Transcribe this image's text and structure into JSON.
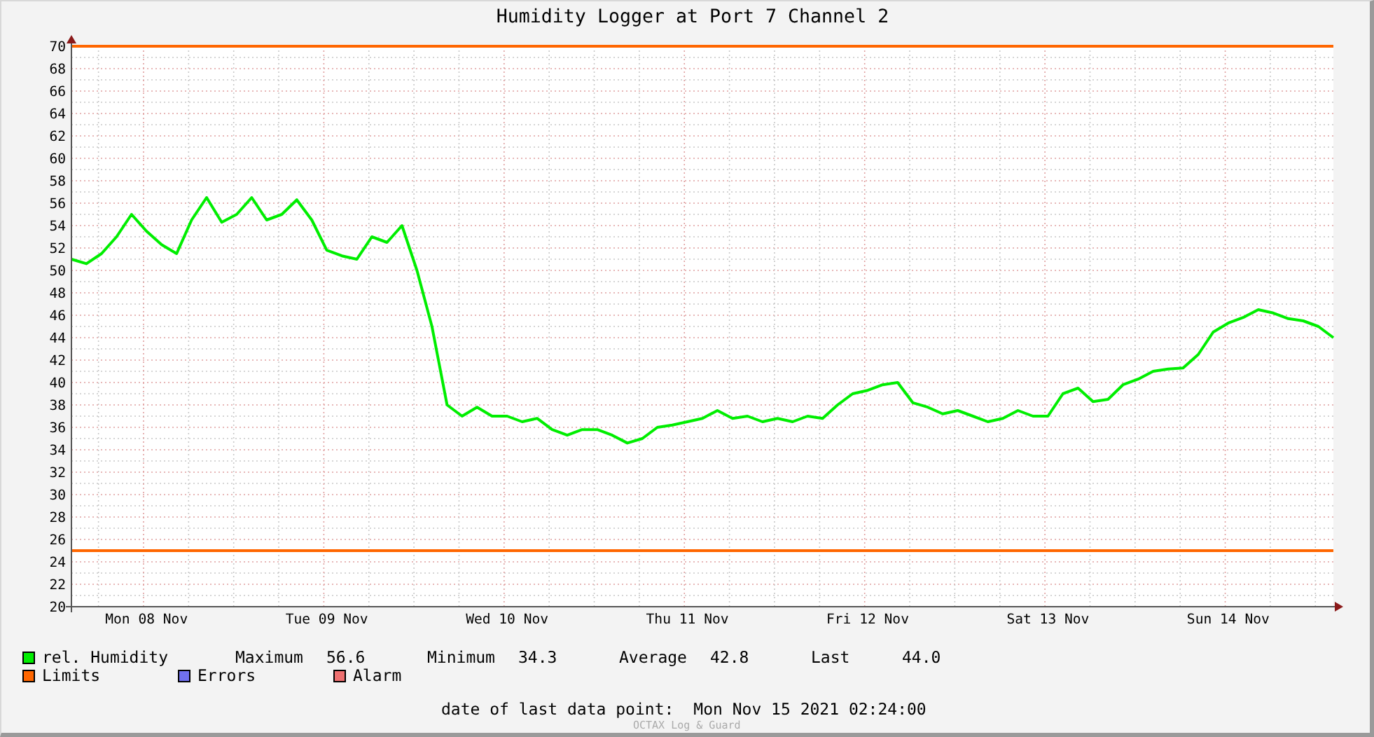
{
  "title": "Humidity Logger at Port 7 Channel 2",
  "chart": {
    "chart_data": {
      "type": "line",
      "ylim": [
        20,
        70
      ],
      "grid": true,
      "ref_lines": [
        {
          "axis": "y",
          "value": 70,
          "color": "#ff6600"
        },
        {
          "axis": "y",
          "value": 25,
          "color": "#ff6600"
        }
      ],
      "yticks": [
        20,
        22,
        24,
        26,
        28,
        30,
        32,
        34,
        36,
        38,
        40,
        42,
        44,
        46,
        48,
        50,
        52,
        54,
        56,
        58,
        60,
        62,
        64,
        66,
        68,
        70
      ],
      "categories": [
        null,
        null,
        null,
        null,
        null,
        "Mon 08 Nov",
        null,
        null,
        null,
        null,
        null,
        null,
        null,
        null,
        null,
        null,
        null,
        "Tue 09 Nov",
        null,
        null,
        null,
        null,
        null,
        null,
        null,
        null,
        null,
        null,
        null,
        "Wed 10 Nov",
        null,
        null,
        null,
        null,
        null,
        null,
        null,
        null,
        null,
        null,
        null,
        "Thu 11 Nov",
        null,
        null,
        null,
        null,
        null,
        null,
        null,
        null,
        null,
        null,
        null,
        "Fri 12 Nov",
        null,
        null,
        null,
        null,
        null,
        null,
        null,
        null,
        null,
        null,
        null,
        "Sat 13 Nov",
        null,
        null,
        null,
        null,
        null,
        null,
        null,
        null,
        null,
        null,
        null,
        "Sun 14 Nov",
        null,
        null,
        null,
        null,
        null,
        null,
        null
      ],
      "series": [
        {
          "name": "rel. Humidity",
          "color": "#00ee00",
          "values": [
            51,
            50.6,
            51.5,
            53,
            55,
            53.5,
            52.3,
            51.5,
            54.5,
            56.5,
            54.3,
            55,
            56.5,
            54.5,
            55,
            56.3,
            54.5,
            51.8,
            51.3,
            51,
            53,
            52.5,
            54,
            50,
            45,
            38,
            37,
            37.8,
            37,
            37,
            36.5,
            36.8,
            35.8,
            35.3,
            35.8,
            35.8,
            35.3,
            34.6,
            35,
            36,
            36.2,
            36.5,
            36.8,
            37.5,
            36.8,
            37,
            36.5,
            36.8,
            36.5,
            37,
            36.8,
            38,
            39,
            39.3,
            39.8,
            40,
            38.2,
            37.8,
            37.2,
            37.5,
            37,
            36.5,
            36.8,
            37.5,
            37,
            37,
            39,
            39.5,
            38.3,
            38.5,
            39.8,
            40.3,
            41,
            41.2,
            41.3,
            42.5,
            44.5,
            45.3,
            45.8,
            46.5,
            46.2,
            45.7,
            45.5,
            45,
            44
          ]
        }
      ]
    }
  },
  "legend": {
    "items": [
      {
        "stats": [
          {
            "label": "Maximum",
            "value": "56.6"
          },
          {
            "label": "Minimum",
            "value": "34.3"
          },
          {
            "label": "Average",
            "value": "42.8"
          },
          {
            "label": "Last",
            "value": "44.0"
          }
        ]
      },
      {
        "label": "Limits",
        "color": "#ff6600"
      },
      {
        "label": "Errors",
        "color": "#7070ee"
      },
      {
        "label": "Alarm",
        "color": "#ee7070"
      }
    ]
  },
  "last_point": {
    "label": "date of last data point:",
    "value": "Mon Nov 15 2021 02:24:00"
  },
  "footer": "OCTAX Log & Guard"
}
